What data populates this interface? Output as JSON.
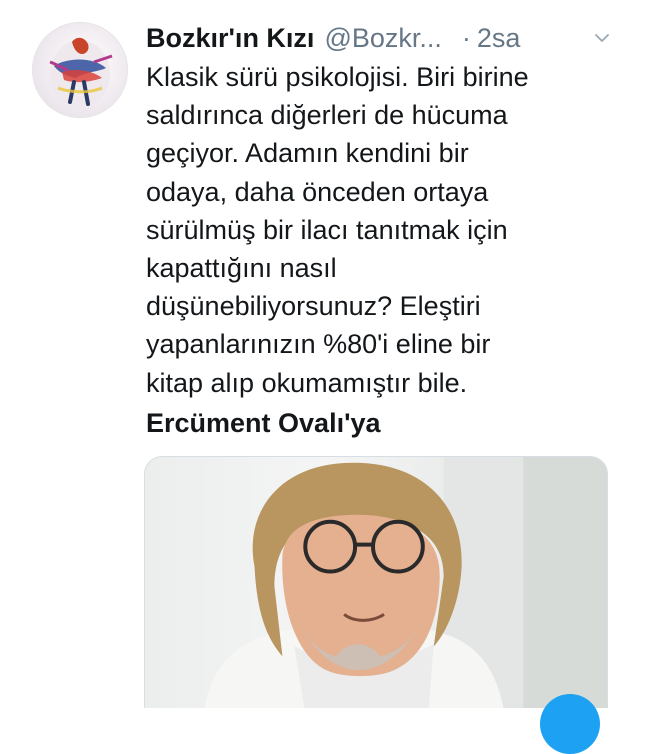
{
  "tweet": {
    "display_name": "Bozkır'ın Kızı",
    "handle": "@Bozkr...",
    "separator": "·",
    "time": "2sa",
    "text_lines": [
      "Klasik sürü psikolojisi. Biri birine",
      "saldırınca diğerleri de hücuma",
      "geçiyor. Adamın kendini bir",
      "odaya, daha önceden ortaya",
      "sürülmüş bir ilacı tanıtmak için",
      "kapattığını nasıl",
      "düşünebiliyorsunuz? Eleştiri",
      "yapanlarınızın %80'i eline bir",
      "kitap alıp okumamıştır bile."
    ],
    "mention": "Ercüment Ovalı'ya"
  },
  "icons": {
    "more": "chevron-down-icon",
    "compose": "compose-fab"
  },
  "colors": {
    "text": "#14171a",
    "secondary": "#657786",
    "accent": "#1da1f2",
    "border": "#d7dee3"
  }
}
